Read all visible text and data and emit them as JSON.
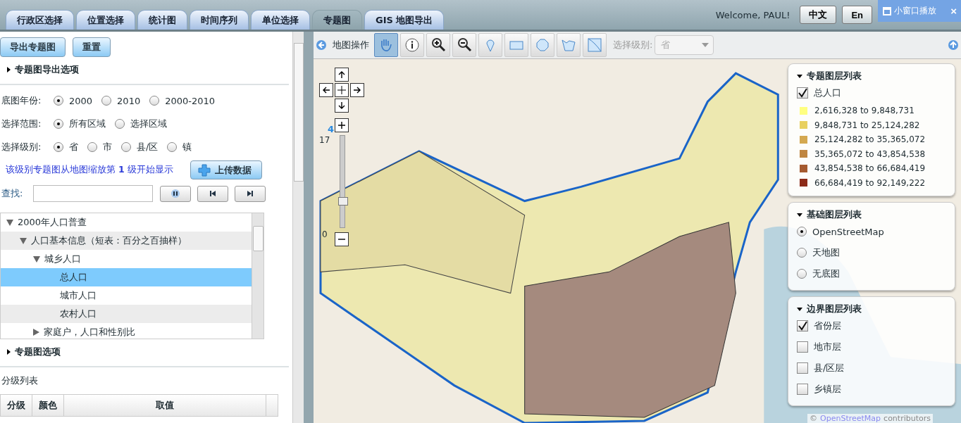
{
  "tabs": [
    {
      "label": "行政区选择",
      "selected": false
    },
    {
      "label": "位置选择",
      "selected": false
    },
    {
      "label": "统计图",
      "selected": false
    },
    {
      "label": "时间序列",
      "selected": false
    },
    {
      "label": "单位选择",
      "selected": false
    },
    {
      "label": "专题图",
      "selected": true
    },
    {
      "label": "GIS 地图导出",
      "selected": false
    }
  ],
  "welcome": "Welcome, PAUL!",
  "language_buttons": [
    "中文",
    "En"
  ],
  "popup": {
    "label": "小窗口播放",
    "close": "×"
  },
  "left_panel": {
    "buttons": [
      "导出专题图",
      "重置"
    ],
    "export_section": {
      "title": "专题图导出选项",
      "expanded": false
    },
    "radio_groups": [
      {
        "label": "底图年份:",
        "options": [
          {
            "label": "2000",
            "selected": true
          },
          {
            "label": "2010",
            "selected": false
          },
          {
            "label": "2000-2010",
            "selected": false
          }
        ]
      },
      {
        "label": "选择范围:",
        "options": [
          {
            "label": "所有区域",
            "selected": true
          },
          {
            "label": "选择区域",
            "selected": false
          }
        ]
      },
      {
        "label": "选择级别:",
        "options": [
          {
            "label": "省",
            "selected": true
          },
          {
            "label": "市",
            "selected": false
          },
          {
            "label": "县/区",
            "selected": false
          },
          {
            "label": "镇",
            "selected": false
          }
        ]
      }
    ],
    "note": "该级别专题图从地图缩放第 **1** 级开始显示",
    "upload_button": "上传数据",
    "search": {
      "label": "查找:"
    },
    "tree": [
      {
        "label": "2000年人口普查",
        "expanded": true,
        "selected": false,
        "children": [
          {
            "label": "人口基本信息（短表：百分之百抽样）",
            "expanded": true,
            "selected": false,
            "children": [
              {
                "label": "城乡人口",
                "expanded": true,
                "selected": false,
                "children": [
                  {
                    "label": "总人口",
                    "selected": true
                  },
                  {
                    "label": "城市人口",
                    "selected": false
                  },
                  {
                    "label": "农村人口",
                    "selected": false
                  }
                ]
              },
              {
                "label": "家庭户，人口和性别比",
                "expanded": false,
                "selected": false
              }
            ]
          }
        ]
      }
    ],
    "options_section": {
      "title": "专题图选项",
      "expanded": false
    },
    "class_list": {
      "title": "分级列表",
      "columns": [
        "分级",
        "颜色",
        "取值"
      ]
    }
  },
  "map": {
    "toolbar_label": "地图操作",
    "tools": [
      {
        "kind": "pan",
        "selected": true
      },
      {
        "kind": "info",
        "selected": false
      },
      {
        "kind": "zoom-in",
        "selected": false
      },
      {
        "kind": "zoom-out",
        "selected": false
      },
      {
        "kind": "point",
        "selected": false
      },
      {
        "kind": "rectangle",
        "selected": false
      },
      {
        "kind": "circle",
        "selected": false
      },
      {
        "kind": "polygon",
        "selected": false
      },
      {
        "kind": "clear",
        "selected": false
      }
    ],
    "level_select": {
      "label": "选择级别:",
      "value": "省",
      "disabled": true
    },
    "zoom": {
      "max": "17",
      "current": "4",
      "min": "0",
      "level": 0.235
    },
    "thematic_layers": {
      "title": "专题图层列表",
      "layer": {
        "label": "总人口",
        "checked": true
      },
      "classes": [
        {
          "label": "2,616,328 to 9,848,731",
          "color": "#ffff80"
        },
        {
          "label": "9,848,731 to 25,124,282",
          "color": "#e8d060"
        },
        {
          "label": "25,124,282 to 35,365,072",
          "color": "#d4a850"
        },
        {
          "label": "35,365,072 to 43,854,538",
          "color": "#bf8540"
        },
        {
          "label": "43,854,538 to 66,684,419",
          "color": "#a55a30"
        },
        {
          "label": "66,684,419 to 92,149,222",
          "color": "#8c2a18"
        }
      ]
    },
    "base_layers": {
      "title": "基础图层列表",
      "options": [
        {
          "label": "OpenStreetMap",
          "selected": true
        },
        {
          "label": "天地图",
          "selected": false
        },
        {
          "label": "无底图",
          "selected": false
        }
      ]
    },
    "boundary_layers": {
      "title": "边界图层列表",
      "items": [
        {
          "label": "省份层",
          "checked": true
        },
        {
          "label": "地市层",
          "checked": false
        },
        {
          "label": "县/区层",
          "checked": false
        },
        {
          "label": "乡镇层",
          "checked": false
        }
      ]
    },
    "attribution": {
      "prefix": "©",
      "link": "OpenStreetMap",
      "suffix": "contributors"
    }
  }
}
